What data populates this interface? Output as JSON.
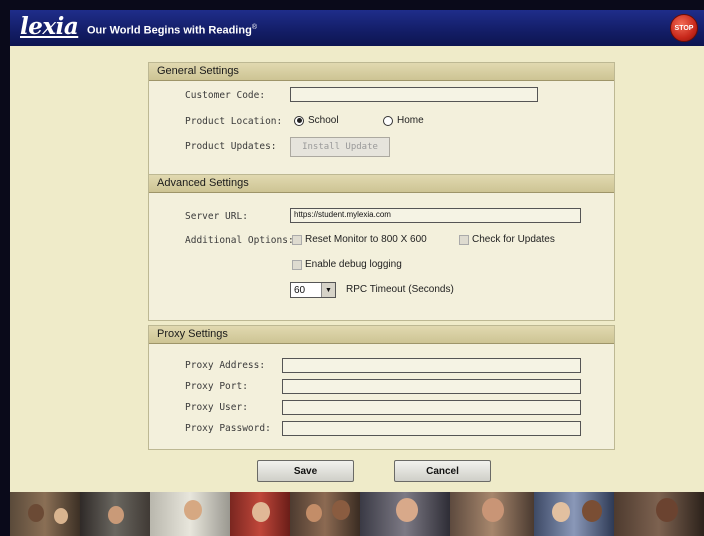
{
  "header": {
    "logo": "lexia",
    "tagline": "Our World Begins with Reading",
    "tagline_mark": "®",
    "stop_label": "STOP"
  },
  "general": {
    "title": "General Settings",
    "customer_code_label": "Customer Code:",
    "customer_code_value": "",
    "product_location_label": "Product Location:",
    "location_options": [
      "School",
      "Home"
    ],
    "location_selected": "School",
    "product_updates_label": "Product Updates:",
    "install_update_label": "Install Update"
  },
  "advanced": {
    "title": "Advanced Settings",
    "server_url_label": "Server URL:",
    "server_url_value": "https://student.mylexia.com",
    "additional_options_label": "Additional Options:",
    "reset_monitor_label": "Reset Monitor to 800 X 600",
    "check_updates_label": "Check for Updates",
    "debug_logging_label": "Enable debug logging",
    "rpc_timeout_value": "60",
    "rpc_timeout_label": "RPC Timeout (Seconds)"
  },
  "proxy": {
    "title": "Proxy Settings",
    "address_label": "Proxy Address:",
    "port_label": "Proxy Port:",
    "user_label": "Proxy User:",
    "password_label": "Proxy Password:"
  },
  "actions": {
    "save_label": "Save",
    "cancel_label": "Cancel"
  },
  "colors": {
    "header_blue": "#131d66",
    "panel_cream": "#efebc9",
    "section_header": "#cdc494",
    "stop_red": "#c8281b"
  }
}
